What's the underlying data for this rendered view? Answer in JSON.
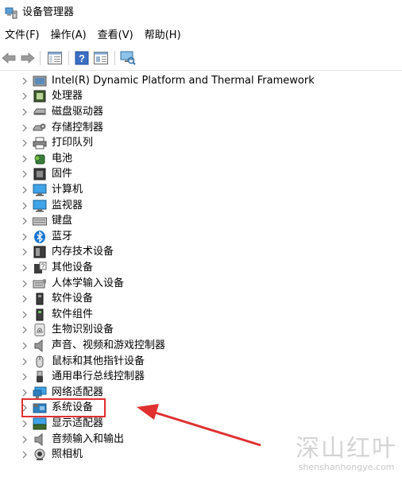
{
  "window": {
    "title": "设备管理器"
  },
  "menu": [
    {
      "label": "文件(F)"
    },
    {
      "label": "操作(A)"
    },
    {
      "label": "查看(V)"
    },
    {
      "label": "帮助(H)"
    }
  ],
  "tree": {
    "items": [
      {
        "label": "Intel(R) Dynamic Platform and Thermal Framework",
        "icon": "device-folder-icon"
      },
      {
        "label": "处理器",
        "icon": "processor-icon"
      },
      {
        "label": "磁盘驱动器",
        "icon": "disk-drive-icon"
      },
      {
        "label": "存储控制器",
        "icon": "storage-controller-icon"
      },
      {
        "label": "打印队列",
        "icon": "printer-icon"
      },
      {
        "label": "电池",
        "icon": "battery-icon"
      },
      {
        "label": "固件",
        "icon": "firmware-icon"
      },
      {
        "label": "计算机",
        "icon": "computer-icon"
      },
      {
        "label": "监视器",
        "icon": "monitor-icon"
      },
      {
        "label": "键盘",
        "icon": "keyboard-icon"
      },
      {
        "label": "蓝牙",
        "icon": "bluetooth-icon"
      },
      {
        "label": "内存技术设备",
        "icon": "memory-device-icon"
      },
      {
        "label": "其他设备",
        "icon": "other-device-icon"
      },
      {
        "label": "人体学输入设备",
        "icon": "hid-icon"
      },
      {
        "label": "软件设备",
        "icon": "software-device-icon"
      },
      {
        "label": "软件组件",
        "icon": "software-component-icon"
      },
      {
        "label": "生物识别设备",
        "icon": "biometric-icon"
      },
      {
        "label": "声音、视频和游戏控制器",
        "icon": "sound-icon"
      },
      {
        "label": "鼠标和其他指针设备",
        "icon": "mouse-icon"
      },
      {
        "label": "通用串行总线控制器",
        "icon": "usb-icon"
      },
      {
        "label": "网络适配器",
        "icon": "network-adapter-icon"
      },
      {
        "label": "系统设备",
        "icon": "system-device-icon"
      },
      {
        "label": "显示适配器",
        "icon": "display-adapter-icon"
      },
      {
        "label": "音频输入和输出",
        "icon": "audio-io-icon"
      },
      {
        "label": "照相机",
        "icon": "camera-icon"
      }
    ]
  },
  "annotation": {
    "highlight_color": "#e03030",
    "highlighted_item": "系统设备"
  },
  "watermark": {
    "text": "深山红叶",
    "url_text": "shenshanhongye.com"
  }
}
